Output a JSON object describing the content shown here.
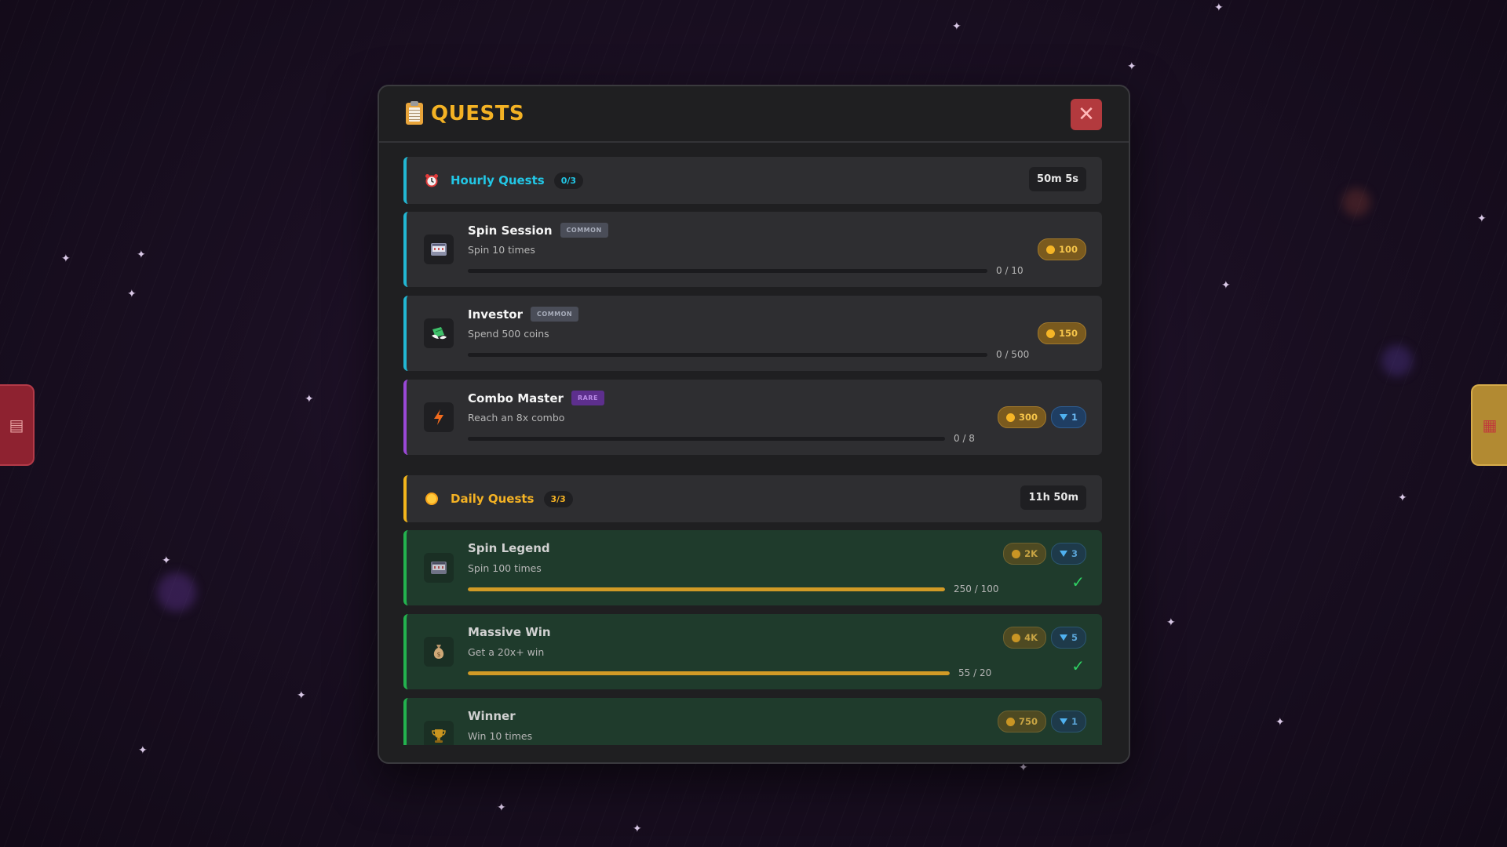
{
  "modal": {
    "title": "QUESTS",
    "close_icon": "✕"
  },
  "hourly": {
    "title": "Hourly Quests",
    "count": "0/3",
    "timer": "50m 5s",
    "icon": "alarm-clock-icon",
    "quests": [
      {
        "name": "Spin Session",
        "rarity": "COMMON",
        "desc": "Spin 10 times",
        "progress_text": "0 / 10",
        "progress": 0,
        "coins": "100",
        "gems": null,
        "icon": "slot-machine-icon"
      },
      {
        "name": "Investor",
        "rarity": "COMMON",
        "desc": "Spend 500 coins",
        "progress_text": "0 / 500",
        "progress": 0,
        "coins": "150",
        "gems": null,
        "icon": "money-wings-icon"
      },
      {
        "name": "Combo Master",
        "rarity": "RARE",
        "desc": "Reach an 8x combo",
        "progress_text": "0 / 8",
        "progress": 0,
        "coins": "300",
        "gems": "1",
        "icon": "lightning-icon"
      }
    ]
  },
  "daily": {
    "title": "Daily Quests",
    "count": "3/3",
    "timer": "11h 50m",
    "icon": "sun-icon",
    "quests": [
      {
        "name": "Spin Legend",
        "desc": "Spin 100 times",
        "progress_text": "250 / 100",
        "progress": 1,
        "coins": "2K",
        "gems": "3",
        "completed": true,
        "icon": "slot-machine-icon"
      },
      {
        "name": "Massive Win",
        "desc": "Get a 20x+ win",
        "progress_text": "55 / 20",
        "progress": 1,
        "coins": "4K",
        "gems": "5",
        "completed": true,
        "icon": "money-bag-icon"
      },
      {
        "name": "Winner",
        "desc": "Win 10 times",
        "coins": "750",
        "gems": "1",
        "completed": true,
        "icon": "trophy-icon"
      }
    ]
  },
  "colors": {
    "accent_gold": "#f4b224",
    "accent_cyan": "#22c7e6",
    "rare_purple": "#9a48d6",
    "complete_green": "#23b24e"
  }
}
